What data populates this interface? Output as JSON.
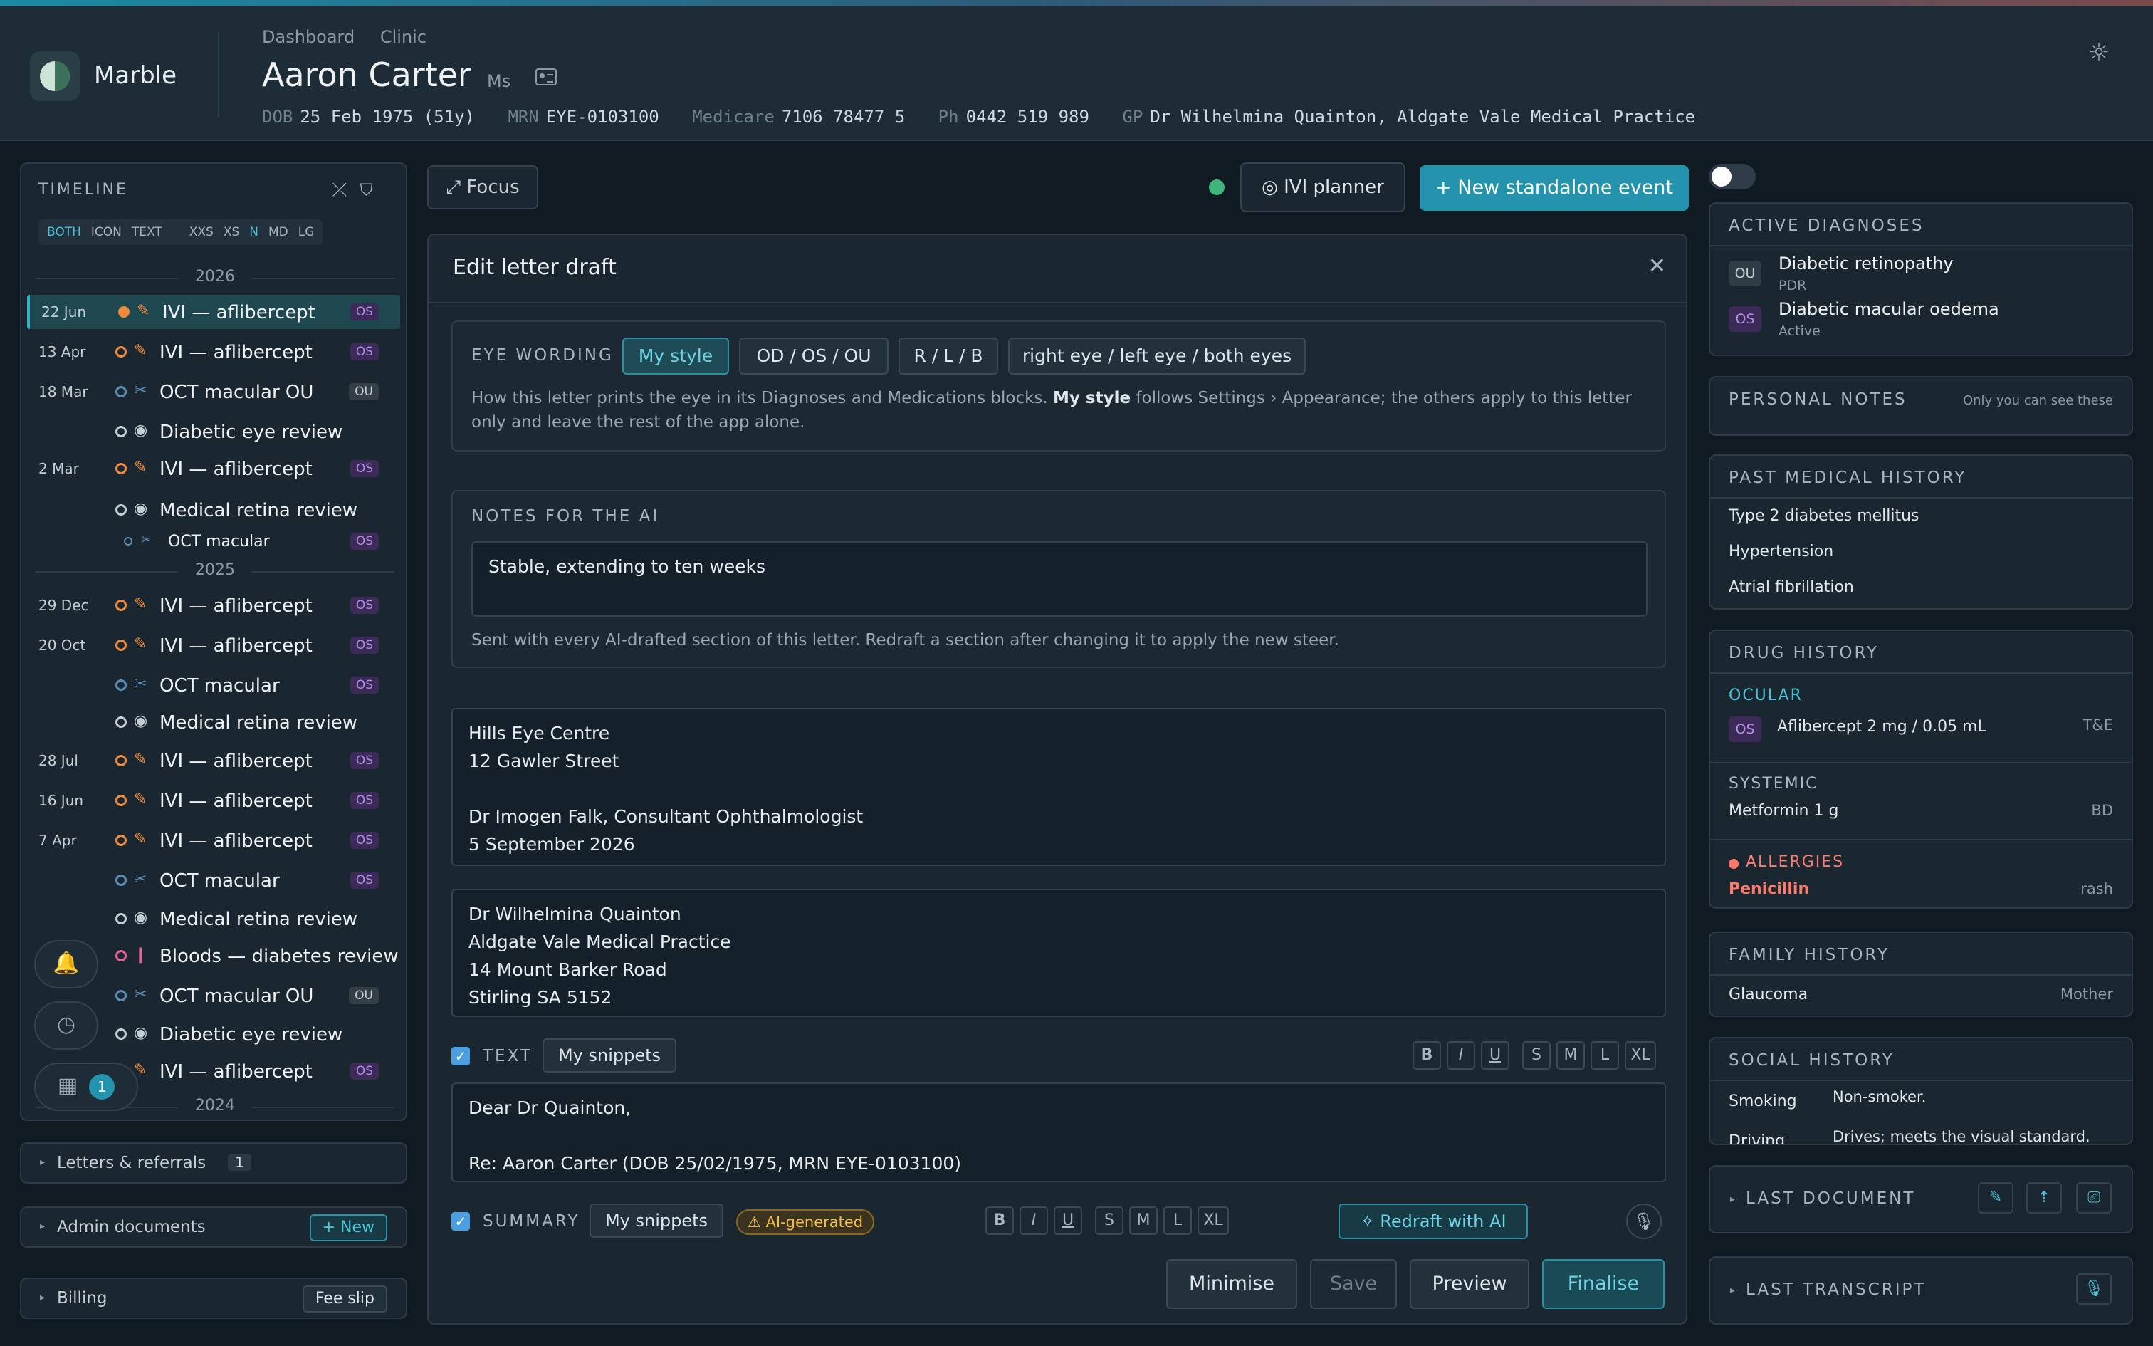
{
  "header": {
    "brand": "Marble",
    "crumbs": [
      "Dashboard",
      "Clinic"
    ],
    "patient_name": "Aaron Carter",
    "patient_title": "Ms",
    "demographics": [
      {
        "k": "DOB",
        "v": "25 Feb 1975 (51y)"
      },
      {
        "k": "MRN",
        "v": "EYE-0103100"
      },
      {
        "k": "Medicare",
        "v": "7106 78477 5"
      },
      {
        "k": "Ph",
        "v": "0442 519 989"
      },
      {
        "k": "GP",
        "v": "Dr Wilhelmina Quainton, Aldgate Vale Medical Practice"
      }
    ]
  },
  "timeline": {
    "title": "TIMELINE",
    "view_modes": [
      "BOTH",
      "ICON",
      "TEXT"
    ],
    "sizes": [
      "XXS",
      "XS",
      "N",
      "MD",
      "LG"
    ],
    "years": [
      "2026",
      "2025",
      "2024"
    ],
    "rows": [
      {
        "date": "22 Jun",
        "label": "IVI — aflibercept",
        "tag": "OS"
      },
      {
        "date": "13 Apr",
        "label": "IVI — aflibercept",
        "tag": "OS"
      },
      {
        "date": "18 Mar",
        "label": "OCT macular OU",
        "tag": "OU"
      },
      {
        "date": "",
        "label": "Diabetic eye review",
        "tag": ""
      },
      {
        "date": "2 Mar",
        "label": "IVI — aflibercept",
        "tag": "OS"
      },
      {
        "date": "",
        "label": "Medical retina review",
        "tag": ""
      },
      {
        "date": "",
        "label": "OCT macular",
        "tag": "OS"
      },
      {
        "date": "29 Dec",
        "label": "IVI — aflibercept",
        "tag": "OS"
      },
      {
        "date": "20 Oct",
        "label": "IVI — aflibercept",
        "tag": "OS"
      },
      {
        "date": "",
        "label": "OCT macular",
        "tag": "OS"
      },
      {
        "date": "",
        "label": "Medical retina review",
        "tag": ""
      },
      {
        "date": "28 Jul",
        "label": "IVI — aflibercept",
        "tag": "OS"
      },
      {
        "date": "16 Jun",
        "label": "IVI — aflibercept",
        "tag": "OS"
      },
      {
        "date": "7 Apr",
        "label": "IVI — aflibercept",
        "tag": "OS"
      },
      {
        "date": "",
        "label": "OCT macular",
        "tag": "OS"
      },
      {
        "date": "",
        "label": "Medical retina review",
        "tag": ""
      },
      {
        "date": "",
        "label": "Bloods — diabetes review",
        "tag": ""
      },
      {
        "date": "",
        "label": "OCT macular OU",
        "tag": "OU"
      },
      {
        "date": "",
        "label": "Diabetic eye review",
        "tag": ""
      },
      {
        "date": "",
        "label": "IVI — aflibercept",
        "tag": "OS"
      }
    ],
    "calendar_count": "1"
  },
  "sections": {
    "letters": "Letters & referrals",
    "letters_count": "1",
    "admin": "Admin documents",
    "admin_new": "+ New",
    "billing": "Billing",
    "billing_btn": "Fee slip"
  },
  "toolbar": {
    "focus": "⤢ Focus",
    "ivi_planner": "◎ IVI planner",
    "new_event": "+ New standalone event"
  },
  "editor": {
    "title": "Edit letter draft",
    "eye_wording": {
      "caption": "EYE WORDING",
      "options": [
        "My style",
        "OD / OS / OU",
        "R / L / B",
        "right eye / left eye / both eyes"
      ],
      "help_1": "How this letter prints the eye in its Diagnoses and Medications blocks. ",
      "help_bold": "My style",
      "help_2": " follows Settings › Appearance; the others apply to this letter only and leave the rest of the app alone."
    },
    "notes": {
      "caption": "NOTES FOR THE AI",
      "value": "Stable, extending to ten weeks",
      "help": "Sent with every AI-drafted section of this letter. Redraft a section after changing it to apply the new steer."
    },
    "from_block": "Hills Eye Centre\n12 Gawler Street\n\nDr Imogen Falk, Consultant Ophthalmologist\n5 September 2026",
    "to_block": "Dr Wilhelmina Quainton\nAldgate Vale Medical Practice\n14 Mount Barker Road\nStirling SA 5152",
    "text_section": {
      "label": "TEXT",
      "snippets": "My snippets",
      "value": "Dear Dr Quainton,\n\nRe: Aaron Carter (DOB 25/02/1975, MRN EYE-0103100)"
    },
    "format_buttons": [
      "B",
      "I",
      "U",
      "S",
      "M",
      "L",
      "XL"
    ],
    "summary_section": {
      "label": "SUMMARY",
      "snippets": "My snippets",
      "ai_badge": "⚠ AI-generated",
      "redraft": "Redraft with AI"
    },
    "footer": {
      "minimise": "Minimise",
      "save": "Save",
      "preview": "Preview",
      "finalise": "Finalise"
    }
  },
  "right": {
    "active_dx": {
      "title": "ACTIVE DIAGNOSES",
      "items": [
        {
          "eye": "OU",
          "name": "Diabetic retinopathy",
          "sub": "PDR"
        },
        {
          "eye": "OS",
          "name": "Diabetic macular oedema",
          "sub": "Active"
        }
      ]
    },
    "personal_notes": {
      "title": "PERSONAL NOTES",
      "note": "Only you can see these"
    },
    "pmh": {
      "title": "PAST MEDICAL HISTORY",
      "items": [
        "Type 2 diabetes mellitus",
        "Hypertension",
        "Atrial fibrillation"
      ]
    },
    "drug": {
      "title": "DRUG HISTORY",
      "ocular": "OCULAR",
      "ocular_item": {
        "eye": "OS",
        "name": "Aflibercept 2 mg / 0.05 mL",
        "regimen": "T&E"
      },
      "systemic": "SYSTEMIC",
      "systemic_item": {
        "name": "Metformin 1 g",
        "freq": "BD"
      },
      "allergies": "ALLERGIES",
      "allergy": {
        "name": "Penicillin",
        "reaction": "rash"
      }
    },
    "family": {
      "title": "FAMILY HISTORY",
      "item": "Glaucoma",
      "rel": "Mother"
    },
    "social": {
      "title": "SOCIAL HISTORY",
      "rows": [
        {
          "k": "Smoking",
          "v": "Non-smoker."
        },
        {
          "k": "Driving",
          "v": "Drives; meets the visual standard."
        }
      ]
    },
    "last_document": "LAST DOCUMENT",
    "last_transcript": "LAST TRANSCRIPT"
  },
  "colors": {
    "accent": "#2493ad",
    "os_tag": "#b58ee8",
    "allergy": "#ff7a6b",
    "ai_badge": "#f0c04a"
  }
}
